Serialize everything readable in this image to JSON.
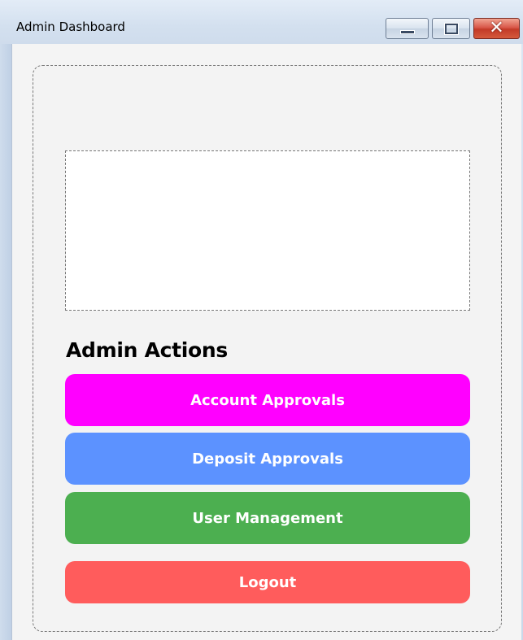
{
  "window": {
    "title": "Admin Dashboard",
    "controls": {
      "minimize_icon": "minimize-icon",
      "maximize_icon": "maximize-icon",
      "close_icon": "close-icon",
      "close_glyph": "✕"
    }
  },
  "dashboard": {
    "section_title": "Admin Actions",
    "buttons": [
      {
        "label": "Account Approvals",
        "color": "#ff00ff"
      },
      {
        "label": "Deposit Approvals",
        "color": "#5c92ff"
      },
      {
        "label": "User Management",
        "color": "#4caf50"
      },
      {
        "label": "Logout",
        "color": "#ff5c5c"
      }
    ]
  }
}
